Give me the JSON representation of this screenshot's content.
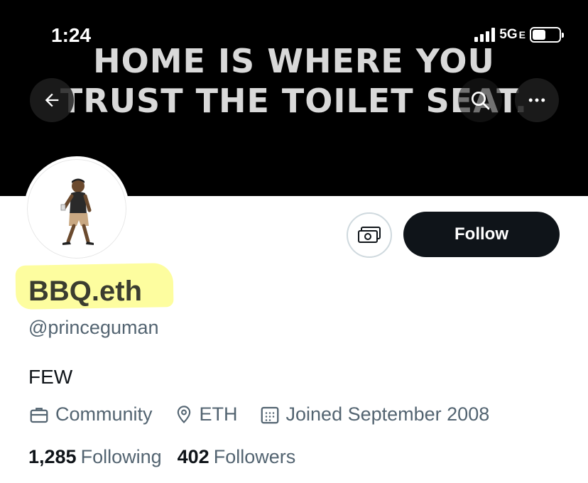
{
  "status_bar": {
    "time": "1:24",
    "network": "5G",
    "network_suffix": "E",
    "battery_level": 0.5
  },
  "banner": {
    "line1": "Home is where you",
    "line2": "trust the toilet seat."
  },
  "header_icons": [
    "back-arrow-icon",
    "search-icon",
    "more-icon"
  ],
  "actions": {
    "tip_icon": "money-icon",
    "follow_label": "Follow"
  },
  "profile": {
    "display_name": "BBQ.eth",
    "handle": "@princeguman",
    "bio": "FEW",
    "category": "Community",
    "location": "ETH",
    "joined": "Joined September 2008",
    "following_count": "1,285",
    "following_label": "Following",
    "followers_count": "402",
    "followers_label": "Followers"
  },
  "colors": {
    "banner_bg": "#000000",
    "follow_bg": "#0f1419",
    "secondary_text": "#536471",
    "highlight": "#fdfd9a"
  }
}
